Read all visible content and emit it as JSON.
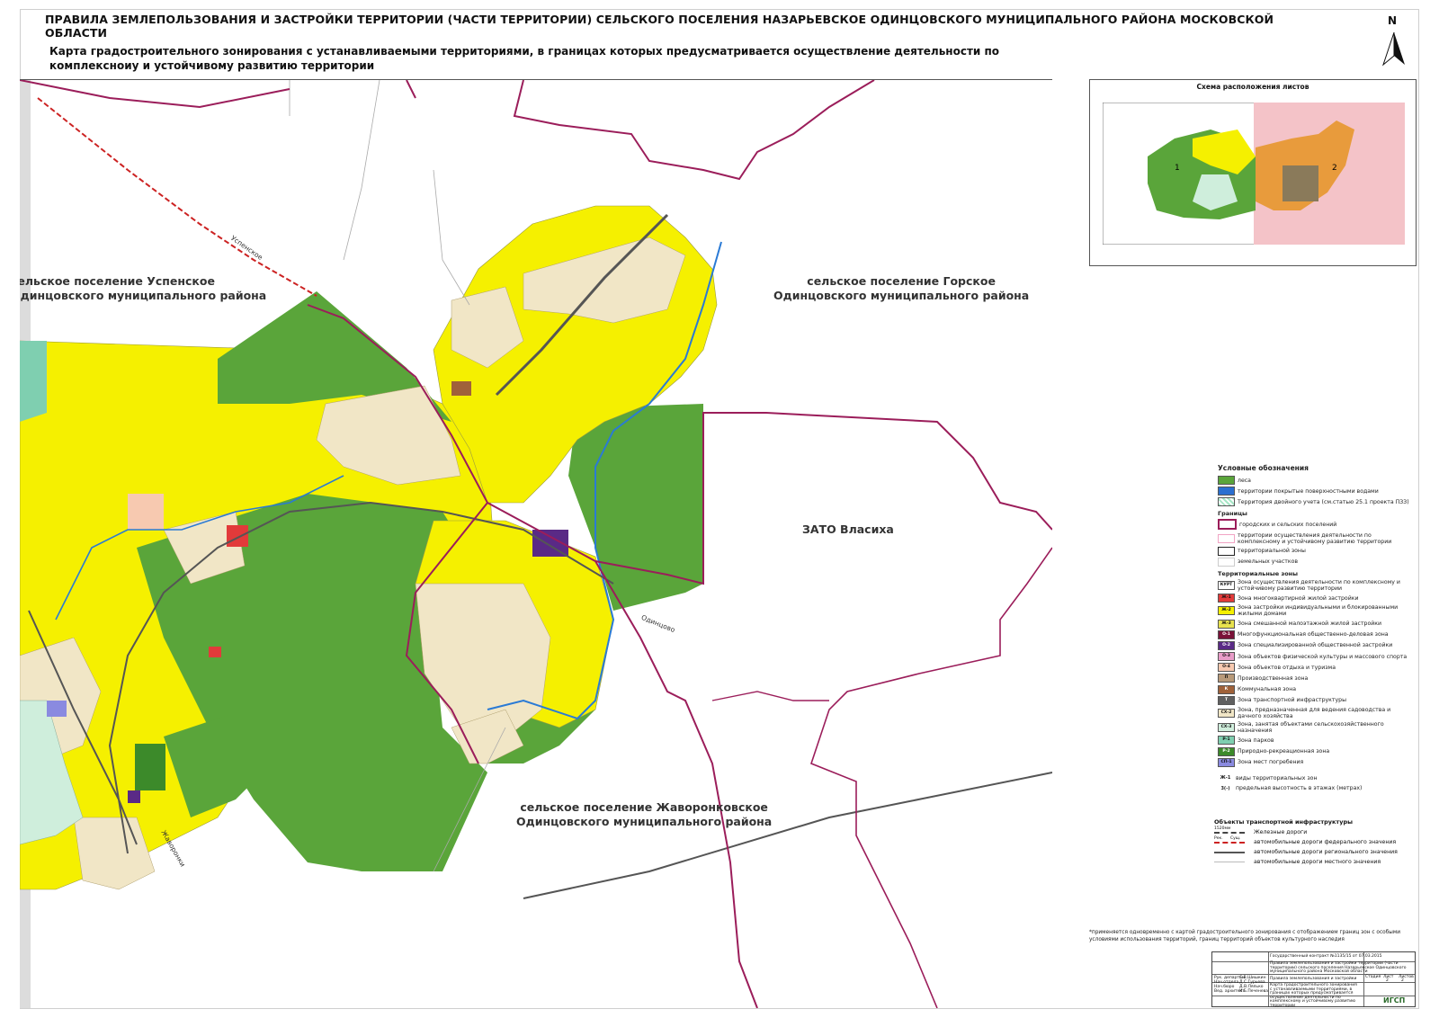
{
  "header": {
    "title": "ПРАВИЛА ЗЕМЛЕПОЛЬЗОВАНИЯ И ЗАСТРОЙКИ ТЕРРИТОРИИ (ЧАСТИ ТЕРРИТОРИИ) СЕЛЬСКОГО ПОСЕЛЕНИЯ  НАЗАРЬЕВСКОЕ ОДИНЦОВСКОГО МУНИЦИПАЛЬНОГО РАЙОНА МОСКОВСКОЙ ОБЛАСТИ",
    "subtitle": "Карта градостроительного зонирования с устанавливаемыми территориями, в границах которых предусматривается осуществление деятельности по комплексноиу и устойчивому развитию территории",
    "north": "N"
  },
  "map": {
    "labels": {
      "uspenskoe": "сельское поселение Успенское\nОдинцовского муниципального района",
      "gorskoe": "сельское поселение Горское\nОдинцовского муниципального района",
      "vlasikha": "ЗАТО Власиха",
      "zhavoronkovskoe": "сельское поселение Жаворонковское\nОдинцовского муниципального района"
    },
    "roads": {
      "uspenskoe": "Успенское",
      "odintsovo": "Одинцово",
      "zhavoronki": "Жаворонки"
    },
    "colors": {
      "forest": "#5aa53a",
      "residential_individual": "#f5f000",
      "gardening": "#f1e6c6",
      "boundary": "#9b1d5a",
      "rail": "#555555",
      "road_federal": "#cc2222",
      "water": "#2a7ad5"
    }
  },
  "inset": {
    "title": "Схема расположения листов",
    "sheet_1": "1",
    "sheet_2": "2"
  },
  "legend": {
    "title": "Условные обозначения",
    "items_top": [
      {
        "label": "леса",
        "color": "#5aa53a"
      },
      {
        "label": "территории покрытые поверхностными водами",
        "color": "#2a6fd0"
      },
      {
        "label": "Территория двойного учета (см.статью 25.1 проекта ПЗЗ)",
        "color": "#a6e6c6"
      }
    ],
    "boundaries_title": "Границы",
    "boundaries": [
      {
        "label": "городских и сельских поселений"
      },
      {
        "label": "территории осуществления деятельности по комплексному и устойчивому развитию территории"
      },
      {
        "label": "территориальной зоны"
      },
      {
        "label": "земельных участков"
      }
    ],
    "zones_title": "Территориальные зоны",
    "zones": [
      {
        "code": "КУРТ",
        "label": "Зона осуществления деятельности по комплексному и устойчивому развитию территории",
        "color": "#ffffff"
      },
      {
        "code": "Ж-1",
        "label": "Зона многоквартирной жилой застройки",
        "color": "#e23a3a"
      },
      {
        "code": "Ж-2",
        "label": "Зона застройки индивидуальными и блокированными жилыми домами",
        "color": "#f5f000"
      },
      {
        "code": "Ж-3",
        "label": "Зона смешанной малоэтажной жилой застройки",
        "color": "#e8e24e"
      },
      {
        "code": "О-1",
        "label": "Многофункциональная общественно-деловая зона",
        "color": "#7a1238"
      },
      {
        "code": "О-2",
        "label": "Зона специализированной общественной застройки",
        "color": "#5a2a86"
      },
      {
        "code": "О-3",
        "label": "Зона объектов физической культуры и массового спорта",
        "color": "#e89cc8"
      },
      {
        "code": "О-4",
        "label": "Зона объектов отдыха и туризма",
        "color": "#f7c9b0"
      },
      {
        "code": "П",
        "label": "Производственная зона",
        "color": "#b89a7a"
      },
      {
        "code": "К",
        "label": "Коммунальная зона",
        "color": "#a0623a"
      },
      {
        "code": "Т",
        "label": "Зона транспортной инфраструктуры",
        "color": "#606060"
      },
      {
        "code": "СХ-2",
        "label": "Зона, предназначенная для ведения садоводства и дачного хозяйства",
        "color": "#f1e6c6"
      },
      {
        "code": "СХ-3",
        "label": "Зона, занятая объектами сельскохозяйственного назначения",
        "color": "#cfeedc"
      },
      {
        "code": "Р-1",
        "label": "Зона парков",
        "color": "#7fcfb0"
      },
      {
        "code": "Р-2",
        "label": "Природно-рекреационная зона",
        "color": "#3c8a2a"
      },
      {
        "code": "СП-1",
        "label": "Зона мест погребения",
        "color": "#8a8ae0"
      }
    ],
    "notes": [
      {
        "code": "Ж-1",
        "label": "виды территориальных зон"
      },
      {
        "code": "3(-)",
        "label": "предельная высотность в этажах (метрах)"
      }
    ]
  },
  "transport": {
    "title": "Объекты транспортной инфраструктуры",
    "items": [
      {
        "label": "Железные дороги"
      },
      {
        "label": "автомобильные дороги федерального значения"
      },
      {
        "label": "автомобильные дороги регионального значения"
      },
      {
        "label": "автомобильные дороги местного значения"
      }
    ],
    "rail_tag": "1520мм",
    "fed_tags": [
      "Рек.",
      "Сущ."
    ]
  },
  "footnote": "*применяется одновременно с картой градостроительного зонирования с отображением границ зон с особыми условиями использования территорий, границ территорий объектов культурного наследия",
  "stamp": {
    "contract": "Государственный контракт №1135/15 от 07.03.2015",
    "desc": "Правила землепользования и застройки территории (части территории) сельского поселения Назарьевское Одинцовского муниципального района Московской области",
    "section": "Правила землепользования и застройки",
    "stage": "Стадия",
    "sheet": "Лист",
    "sheets": "Листов",
    "sheet_val": "2",
    "sheets_val": "2",
    "map_desc": "Карта градостроительного зонирования с устанавливаемыми территориями, в границах которых предусматривается осуществление деятельности по комплексному и устойчивому развитию территории",
    "org": "ИГСП",
    "roles": [
      "Рук. департам.",
      "Нач.отдела",
      "Нач.бюро",
      "Вед. архитект."
    ],
    "names": [
      "С.В.Шишкин",
      "Д.С.Гурьева",
      "Д.В.Лялько",
      "И.Б.Печенева"
    ]
  }
}
